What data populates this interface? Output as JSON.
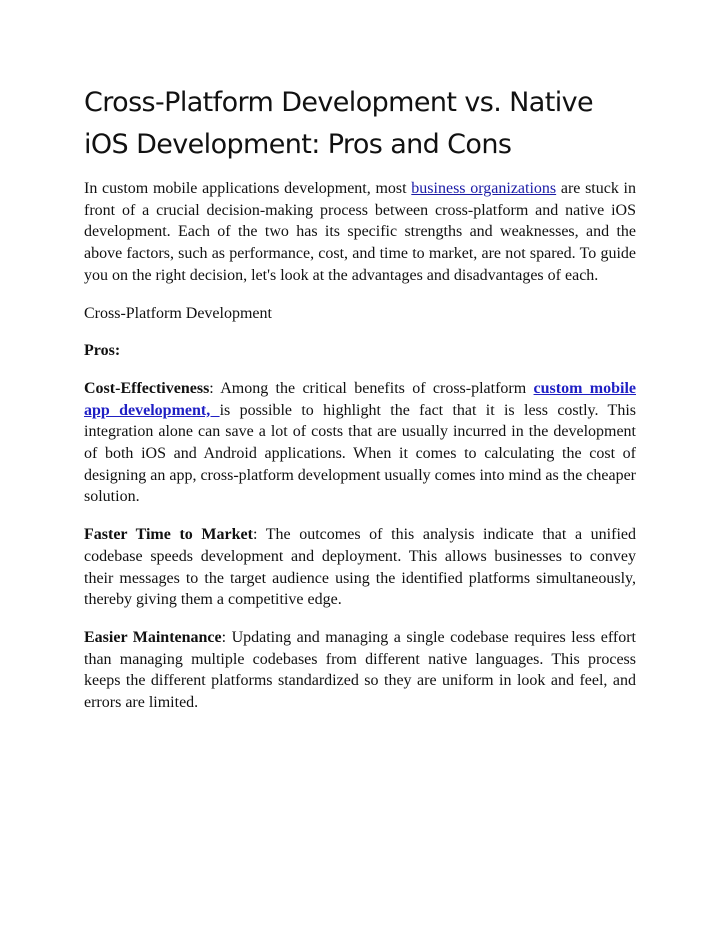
{
  "title": "Cross-Platform Development vs. Native iOS Development: Pros and Cons",
  "intro": {
    "before_link": "In custom mobile applications development, most ",
    "link_text": "business organizations",
    "after_link": " are stuck in front of a crucial decision-making process between cross-platform and native iOS development. Each of the two has its specific strengths and weaknesses, and the above factors, such  as performance, cost, and time to market, are not spared. To guide you on the right decision, let's look at the advantages and disadvantages of each."
  },
  "section_heading": "Cross-Platform Development",
  "pros_label": "Pros:",
  "pros": [
    {
      "term": "Cost-Effectiveness",
      "before_link": ":  Among the critical  benefits of  cross-platform ",
      "link_text": "custom mobile app development, ",
      "after_link": "is possible to highlight the fact that it is less costly. This integration alone can save a lot of costs that are usually incurred in the development of both iOS and Android applications. When it comes to calculating the cost of designing an app, cross-platform development usually comes into mind as the cheaper solution."
    },
    {
      "term": "Faster Time to Market",
      "text": ": The outcomes of this analysis indicate that a unified codebase speeds development and deployment. This allows businesses to convey their messages to the target audience using the identified platforms simultaneously, thereby giving them a competitive edge."
    },
    {
      "term": "Easier Maintenance",
      "text": ": Updating and managing a single codebase requires less effort than managing multiple codebases from different native languages. This process keeps the different platforms standardized so they are uniform in look and feel, and errors are limited."
    }
  ],
  "colors": {
    "link": "#1a1aa6",
    "text": "#111111",
    "background": "#ffffff"
  }
}
